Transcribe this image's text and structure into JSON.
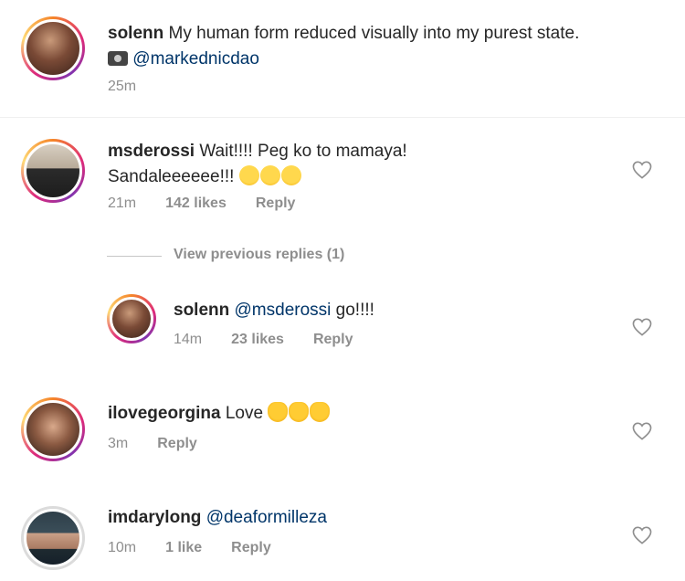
{
  "caption": {
    "username": "solenn",
    "text": "My human form reduced visually into my purest state.",
    "camera_icon": "camera-icon",
    "mention": "@markednicdao",
    "time": "25m"
  },
  "comments": [
    {
      "username": "msderossi",
      "text_line1": "Wait!!!! Peg ko to mamaya!",
      "text_line2": "Sandaleeeeee!!!",
      "emoji": "laughing-emoji",
      "time": "21m",
      "likes": "142 likes",
      "reply": "Reply"
    },
    {
      "username": "ilovegeorgina",
      "text": "Love",
      "emoji": "clapping-emoji",
      "time": "3m",
      "reply": "Reply"
    },
    {
      "username": "imdarylong",
      "mention": "@deaformilleza",
      "time": "10m",
      "likes": "1 like",
      "reply": "Reply"
    }
  ],
  "view_previous": "View previous replies (1)",
  "reply": {
    "username": "solenn",
    "mention": "@msderossi",
    "text": "go!!!!",
    "time": "14m",
    "likes": "23 likes",
    "reply": "Reply"
  },
  "colors": {
    "mention": "#003569",
    "meta": "#8e8e8e",
    "text": "#262626"
  }
}
